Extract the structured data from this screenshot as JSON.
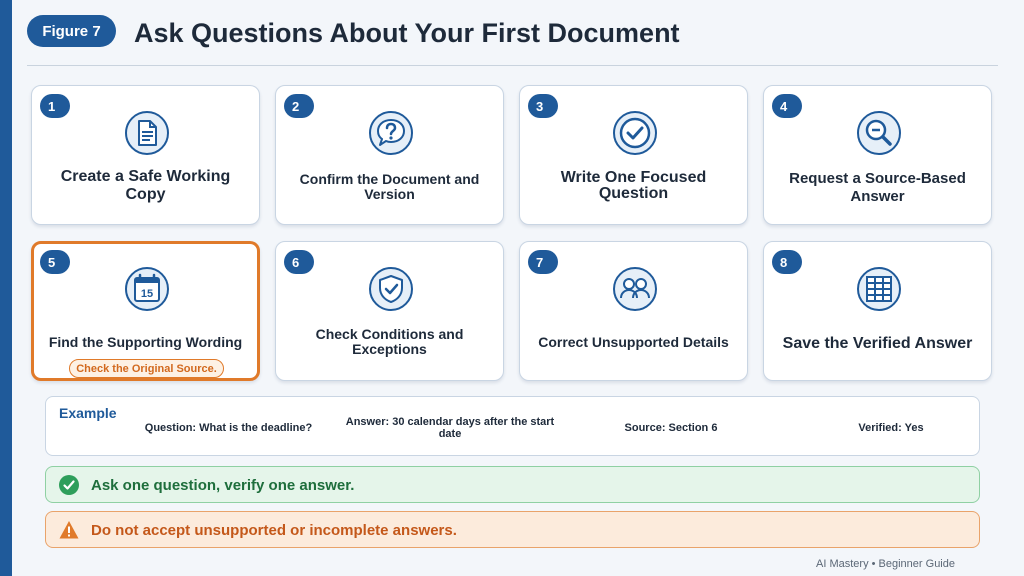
{
  "header": {
    "figure_label": "Figure 7",
    "title": "Ask Questions About Your First Document"
  },
  "steps": [
    {
      "number": "1",
      "label": "Create a Safe Working Copy",
      "icon": "document-icon"
    },
    {
      "number": "2",
      "label": "Confirm the Document and Version",
      "icon": "question-bubble-icon"
    },
    {
      "number": "3",
      "label": "Write One Focused Question",
      "icon": "check-circle-icon"
    },
    {
      "number": "4",
      "label": "Request a Source-Based Answer",
      "icon": "magnifier-icon"
    },
    {
      "number": "5",
      "label": "Find the Supporting Wording",
      "icon": "calendar-icon",
      "calendar_day": "15",
      "tag": "Check the Original Source.",
      "active": true
    },
    {
      "number": "6",
      "label": "Check Conditions and Exceptions",
      "icon": "shield-check-icon"
    },
    {
      "number": "7",
      "label": "Correct Unsupported Details",
      "icon": "people-icon"
    },
    {
      "number": "8",
      "label": "Save the Verified Answer",
      "icon": "grid-table-icon"
    }
  ],
  "example": {
    "label": "Example",
    "question": "Question: What is the deadline?",
    "answer": "Answer: 30 calendar days after the start date",
    "source": "Source: Section 6",
    "verified": "Verified: Yes"
  },
  "banners": {
    "success": "Ask one question, verify one answer.",
    "warning": "Do not accept unsupported or incomplete answers."
  },
  "footer": "AI Mastery • Beginner Guide",
  "colors": {
    "primary": "#1f5a9a",
    "accent_orange": "#e07a2a",
    "success_green": "#2e9e5b",
    "background": "#f3f6fa"
  }
}
